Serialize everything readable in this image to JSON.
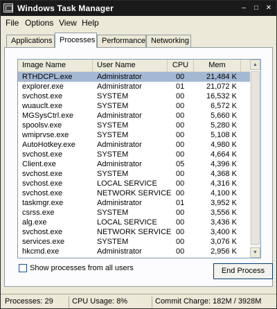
{
  "window": {
    "title": "Windows Task Manager",
    "min_glyph": "–",
    "max_glyph": "□",
    "close_glyph": "✕"
  },
  "menu": [
    "File",
    "Options",
    "View",
    "Help"
  ],
  "tabs": [
    {
      "label": "Applications",
      "active": false
    },
    {
      "label": "Processes",
      "active": true
    },
    {
      "label": "Performance",
      "active": false
    },
    {
      "label": "Networking",
      "active": false
    }
  ],
  "columns": {
    "image_name": "Image Name",
    "user_name": "User Name",
    "cpu": "CPU",
    "mem_usage": "Mem Usage"
  },
  "processes": [
    {
      "name": "RTHDCPL.exe",
      "user": "Administrator",
      "cpu": "00",
      "mem": "21,484 K",
      "selected": true
    },
    {
      "name": "explorer.exe",
      "user": "Administrator",
      "cpu": "01",
      "mem": "21,072 K"
    },
    {
      "name": "svchost.exe",
      "user": "SYSTEM",
      "cpu": "00",
      "mem": "16,532 K"
    },
    {
      "name": "wuauclt.exe",
      "user": "SYSTEM",
      "cpu": "00",
      "mem": "6,572 K"
    },
    {
      "name": "MGSysCtrl.exe",
      "user": "Administrator",
      "cpu": "00",
      "mem": "5,660 K"
    },
    {
      "name": "spoolsv.exe",
      "user": "SYSTEM",
      "cpu": "00",
      "mem": "5,280 K"
    },
    {
      "name": "wmiprvse.exe",
      "user": "SYSTEM",
      "cpu": "00",
      "mem": "5,108 K"
    },
    {
      "name": "AutoHotkey.exe",
      "user": "Administrator",
      "cpu": "00",
      "mem": "4,980 K"
    },
    {
      "name": "svchost.exe",
      "user": "SYSTEM",
      "cpu": "00",
      "mem": "4,664 K"
    },
    {
      "name": "Client.exe",
      "user": "Administrator",
      "cpu": "05",
      "mem": "4,396 K"
    },
    {
      "name": "svchost.exe",
      "user": "SYSTEM",
      "cpu": "00",
      "mem": "4,368 K"
    },
    {
      "name": "svchost.exe",
      "user": "LOCAL SERVICE",
      "cpu": "00",
      "mem": "4,316 K"
    },
    {
      "name": "svchost.exe",
      "user": "NETWORK SERVICE",
      "cpu": "00",
      "mem": "4,100 K"
    },
    {
      "name": "taskmgr.exe",
      "user": "Administrator",
      "cpu": "01",
      "mem": "3,952 K"
    },
    {
      "name": "csrss.exe",
      "user": "SYSTEM",
      "cpu": "00",
      "mem": "3,556 K"
    },
    {
      "name": "alg.exe",
      "user": "LOCAL SERVICE",
      "cpu": "00",
      "mem": "3,436 K"
    },
    {
      "name": "svchost.exe",
      "user": "NETWORK SERVICE",
      "cpu": "00",
      "mem": "3,400 K"
    },
    {
      "name": "services.exe",
      "user": "SYSTEM",
      "cpu": "00",
      "mem": "3,076 K"
    },
    {
      "name": "hkcmd.exe",
      "user": "Administrator",
      "cpu": "00",
      "mem": "2,956 K"
    }
  ],
  "show_all_label": "Show processes from all users",
  "end_process_label": "End Process",
  "status": {
    "processes": "Processes: 29",
    "cpu": "CPU Usage: 8%",
    "commit": "Commit Charge: 182M / 3928M"
  },
  "colors": {
    "selection": "#a4b8d4",
    "titlebar": "#1a1a1a",
    "face": "#ece9d8"
  }
}
